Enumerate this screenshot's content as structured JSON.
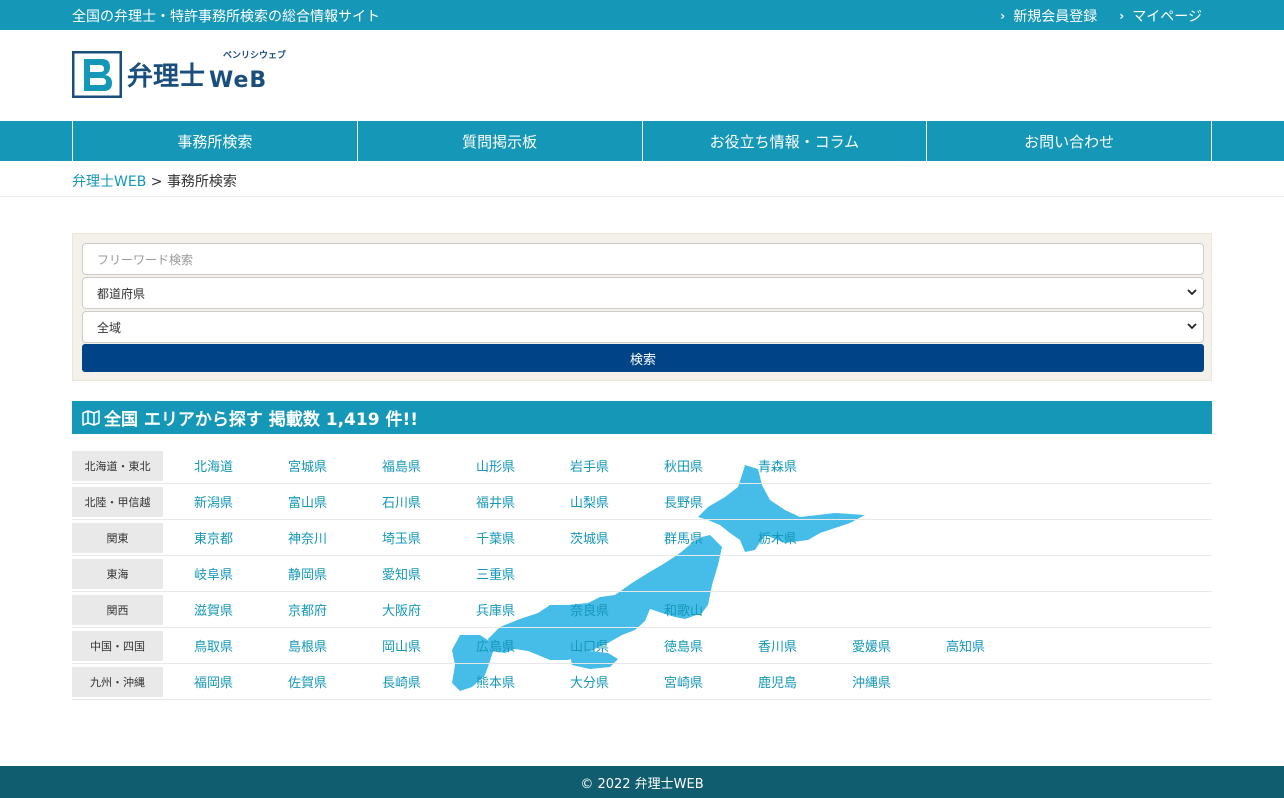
{
  "topbar": {
    "tagline": "全国の弁理士・特許事務所検索の総合情報サイト",
    "links": [
      {
        "label": "新規会員登録"
      },
      {
        "label": "マイページ"
      }
    ]
  },
  "logo": {
    "text": "弁理士",
    "web": "WeB",
    "ruby": "ベンリシウェブ"
  },
  "nav": {
    "items": [
      {
        "label": "事務所検索"
      },
      {
        "label": "質問掲示板"
      },
      {
        "label": "お役立ち情報・コラム"
      },
      {
        "label": "お問い合わせ"
      }
    ]
  },
  "breadcrumb": {
    "home": "弁理士WEB",
    "separator": " > ",
    "current": "事務所検索"
  },
  "search": {
    "keyword_placeholder": "フリーワード検索",
    "prefecture_selected": "都道府県",
    "area_selected": "全域",
    "button_label": "検索"
  },
  "area": {
    "heading": "全国 エリアから探す 掲載数 1,419 件!!",
    "regions": [
      {
        "label": "北海道・東北",
        "prefs": [
          "北海道",
          "宮城県",
          "福島県",
          "山形県",
          "岩手県",
          "秋田県",
          "青森県"
        ]
      },
      {
        "label": "北陸・甲信越",
        "prefs": [
          "新潟県",
          "富山県",
          "石川県",
          "福井県",
          "山梨県",
          "長野県"
        ]
      },
      {
        "label": "関東",
        "prefs": [
          "東京都",
          "神奈川",
          "埼玉県",
          "千葉県",
          "茨城県",
          "群馬県",
          "栃木県"
        ]
      },
      {
        "label": "東海",
        "prefs": [
          "岐阜県",
          "静岡県",
          "愛知県",
          "三重県"
        ]
      },
      {
        "label": "関西",
        "prefs": [
          "滋賀県",
          "京都府",
          "大阪府",
          "兵庫県",
          "奈良県",
          "和歌山"
        ]
      },
      {
        "label": "中国・四国",
        "prefs": [
          "鳥取県",
          "島根県",
          "岡山県",
          "広島県",
          "山口県",
          "徳島県",
          "香川県",
          "愛媛県",
          "高知県"
        ]
      },
      {
        "label": "九州・沖縄",
        "prefs": [
          "福岡県",
          "佐賀県",
          "長崎県",
          "熊本県",
          "大分県",
          "宮崎県",
          "鹿児島",
          "沖縄県"
        ]
      }
    ]
  },
  "footer": {
    "copyright": "© 2022 弁理士WEB"
  },
  "colors": {
    "primary": "#1597b8",
    "button": "#004386",
    "footer": "#0f5d6e",
    "map": "#45bde8"
  }
}
